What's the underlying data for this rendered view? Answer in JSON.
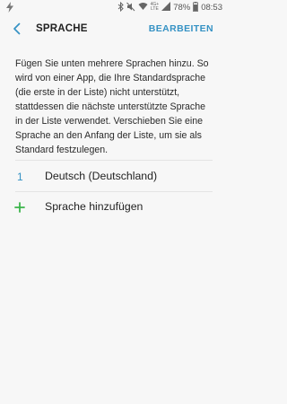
{
  "status_bar": {
    "network_top": "4G+",
    "network_bottom": "LTE",
    "battery": "78%",
    "time": "08:53"
  },
  "header": {
    "title": "SPRACHE",
    "edit_label": "BEARBEITEN"
  },
  "description": "Fügen Sie unten mehrere Sprachen hinzu. So wird von einer App, die Ihre Standardsprache (die erste in der Liste) nicht unterstützt, stattdessen die nächste unterstützte Sprache in der Liste verwendet. Verschieben Sie eine Sprache an den Anfang der Liste, um sie als Standard festzulegen.",
  "languages": [
    {
      "index": "1",
      "name": "Deutsch (Deutschland)"
    }
  ],
  "add_language_label": "Sprache hinzufügen",
  "colors": {
    "accent": "#3592c4",
    "add_icon": "#3bb54a",
    "background": "#f7f7f7"
  }
}
